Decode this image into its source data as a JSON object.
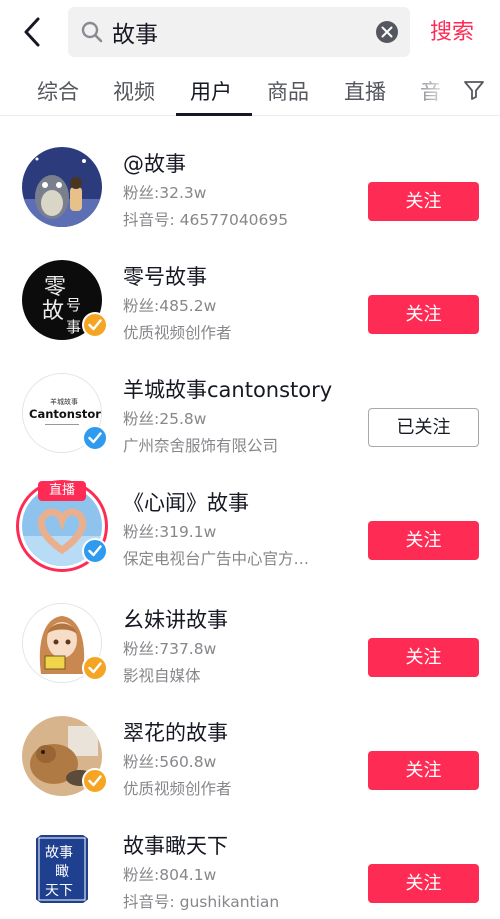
{
  "search": {
    "query": "故事",
    "submit_label": "搜索"
  },
  "tabs": [
    {
      "label": "综合"
    },
    {
      "label": "视频"
    },
    {
      "label": "用户"
    },
    {
      "label": "商品"
    },
    {
      "label": "直播"
    },
    {
      "label": "音"
    }
  ],
  "active_tab": "用户",
  "colors": {
    "accent": "#fe2c55",
    "verified_gold": "#f5a524",
    "verified_blue": "#2e9bf0"
  },
  "icons": {
    "back": "back-arrow-icon",
    "search": "search-icon",
    "clear": "clear-icon",
    "filter": "filter-icon",
    "verified": "verified-check-icon"
  },
  "users": [
    {
      "name": "@故事",
      "fans": "粉丝:32.3w",
      "sub": "抖音号: 46577040695",
      "button": "关注",
      "followed": false,
      "badge": ""
    },
    {
      "name": "零号故事",
      "fans": "粉丝:485.2w",
      "sub": "优质视频创作者",
      "button": "关注",
      "followed": false,
      "badge": "gold"
    },
    {
      "name": "羊城故事cantonstory",
      "fans": "粉丝:25.8w",
      "sub": "广州奈舍服饰有限公司",
      "button": "已关注",
      "followed": true,
      "badge": "blue",
      "avatar_text": "羊城故事",
      "avatar_text2": "Cantonstory"
    },
    {
      "name": "《心闻》故事",
      "fans": "粉丝:319.1w",
      "sub": "保定电视台广告中心官方…",
      "button": "关注",
      "followed": false,
      "badge": "blue",
      "live_label": "直播"
    },
    {
      "name": "幺妹讲故事",
      "fans": "粉丝:737.8w",
      "sub": "影视自媒体",
      "button": "关注",
      "followed": false,
      "badge": "gold"
    },
    {
      "name": "翠花的故事",
      "fans": "粉丝:560.8w",
      "sub": "优质视频创作者",
      "button": "关注",
      "followed": false,
      "badge": "gold"
    },
    {
      "name": "故事瞰天下",
      "fans": "粉丝:804.1w",
      "sub": "抖音号: gushikantian",
      "button": "关注",
      "followed": false,
      "badge": ""
    }
  ],
  "avatar_texts": {
    "zero": [
      "零",
      "故",
      "号",
      "事"
    ],
    "kantian": [
      "故事",
      "瞰",
      "天下"
    ]
  }
}
